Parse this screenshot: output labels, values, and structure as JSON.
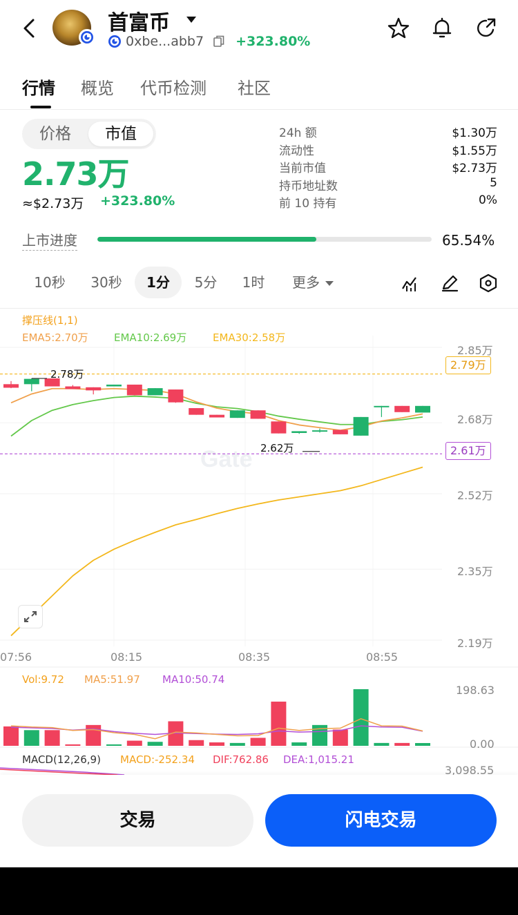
{
  "header": {
    "title": "首富币",
    "address": "0xbe...abb7",
    "change": "+323.80%"
  },
  "tabs": [
    {
      "label": "行情",
      "active": true
    },
    {
      "label": "概览",
      "active": false
    },
    {
      "label": "代币检测",
      "active": false
    },
    {
      "label": "社区",
      "active": false
    }
  ],
  "toggle": {
    "price_label": "价格",
    "mcap_label": "市值",
    "selected": "市值"
  },
  "price": {
    "main": "2.73万",
    "usd": "≈$2.73万",
    "change": "+323.80%"
  },
  "stats": [
    {
      "label": "24h  额",
      "value": "$1.30万"
    },
    {
      "label": "流动性",
      "value": "$1.55万"
    },
    {
      "label": "当前市值",
      "value": "$2.73万"
    },
    {
      "label": "持币地址数",
      "value": "5"
    },
    {
      "label": "前 10 持有",
      "value": "0%"
    }
  ],
  "progress": {
    "label": "上市进度",
    "value_text": "65.54%",
    "fraction": 0.6554
  },
  "intervals": [
    {
      "label": "10秒",
      "selected": false
    },
    {
      "label": "30秒",
      "selected": false
    },
    {
      "label": "1分",
      "selected": true
    },
    {
      "label": "5分",
      "selected": false
    },
    {
      "label": "1时",
      "selected": false
    },
    {
      "label": "更多",
      "selected": false
    }
  ],
  "indicators": {
    "support_label": "撑压线(1,1)",
    "ema5": "EMA5:2.70万",
    "ema10": "EMA10:2.69万",
    "ema30": "EMA30:2.58万"
  },
  "colors": {
    "up": "#20b26c",
    "down": "#f0415c",
    "ema5": "#f0a04b",
    "ema10": "#63c84a",
    "ema30": "#f3b71c",
    "resistance": "#f3b71c",
    "support": "#b24fd6",
    "ma5": "#f0a04b",
    "ma10": "#b24fd6",
    "brand_blue": "#0b5ff9"
  },
  "chart_data": {
    "type": "candlestick",
    "y_unit": "万",
    "y_ticks": [
      "2.85万",
      "2.68万",
      "2.52万",
      "2.35万",
      "2.19万"
    ],
    "x_ticks": [
      "07:56",
      "08:15",
      "08:35",
      "08:55"
    ],
    "resistance_label": "2.79万",
    "support_label": "2.61万",
    "high_marker": "2.78万",
    "low_marker": "2.62万",
    "candles": [
      {
        "open": 2.767,
        "high": 2.774,
        "low": 2.758,
        "close": 2.759
      },
      {
        "open": 2.767,
        "high": 2.78,
        "low": 2.751,
        "close": 2.779
      },
      {
        "open": 2.78,
        "high": 2.78,
        "low": 2.762,
        "close": 2.762
      },
      {
        "open": 2.762,
        "high": 2.765,
        "low": 2.756,
        "close": 2.756
      },
      {
        "open": 2.76,
        "high": 2.76,
        "low": 2.744,
        "close": 2.753
      },
      {
        "open": 2.762,
        "high": 2.766,
        "low": 2.762,
        "close": 2.766
      },
      {
        "open": 2.766,
        "high": 2.766,
        "low": 2.742,
        "close": 2.742
      },
      {
        "open": 2.742,
        "high": 2.758,
        "low": 2.742,
        "close": 2.758
      },
      {
        "open": 2.755,
        "high": 2.755,
        "low": 2.725,
        "close": 2.726
      },
      {
        "open": 2.713,
        "high": 2.713,
        "low": 2.698,
        "close": 2.698
      },
      {
        "open": 2.698,
        "high": 2.698,
        "low": 2.692,
        "close": 2.692
      },
      {
        "open": 2.691,
        "high": 2.708,
        "low": 2.691,
        "close": 2.708
      },
      {
        "open": 2.708,
        "high": 2.708,
        "low": 2.689,
        "close": 2.689
      },
      {
        "open": 2.683,
        "high": 2.683,
        "low": 2.656,
        "close": 2.656
      },
      {
        "open": 2.657,
        "high": 2.661,
        "low": 2.655,
        "close": 2.661
      },
      {
        "open": 2.661,
        "high": 2.667,
        "low": 2.658,
        "close": 2.663
      },
      {
        "open": 2.664,
        "high": 2.664,
        "low": 2.654,
        "close": 2.654
      },
      {
        "open": 2.651,
        "high": 2.693,
        "low": 2.651,
        "close": 2.693
      },
      {
        "open": 2.718,
        "high": 2.718,
        "low": 2.693,
        "close": 2.718
      },
      {
        "open": 2.718,
        "high": 2.718,
        "low": 2.704,
        "close": 2.704
      },
      {
        "open": 2.703,
        "high": 2.718,
        "low": 2.703,
        "close": 2.718
      }
    ],
    "ema5": [
      2.725,
      2.745,
      2.757,
      2.757,
      2.755,
      2.757,
      2.755,
      2.753,
      2.745,
      2.727,
      2.713,
      2.705,
      2.7,
      2.685,
      2.675,
      2.669,
      2.663,
      2.671,
      2.684,
      2.691,
      2.7
    ],
    "ema10": [
      2.65,
      2.685,
      2.708,
      2.721,
      2.73,
      2.737,
      2.74,
      2.738,
      2.735,
      2.724,
      2.716,
      2.712,
      2.705,
      2.695,
      2.688,
      2.682,
      2.676,
      2.676,
      2.683,
      2.687,
      2.693
    ],
    "ema30": [
      2.2,
      2.245,
      2.29,
      2.335,
      2.37,
      2.395,
      2.415,
      2.433,
      2.45,
      2.462,
      2.475,
      2.487,
      2.497,
      2.506,
      2.513,
      2.52,
      2.527,
      2.538,
      2.552,
      2.566,
      2.58
    ],
    "volume": {
      "labels": {
        "vol": "Vol:9.72",
        "ma5": "MA5:51.97",
        "ma10": "MA10:50.74"
      },
      "y_ticks": [
        "198.63",
        "0.00"
      ],
      "max": 198.63,
      "bars": [
        68,
        55,
        55,
        5,
        73,
        5,
        18,
        14,
        86,
        20,
        12,
        10,
        28,
        155,
        12,
        73,
        57,
        198.63,
        10,
        10,
        9.72
      ],
      "ma5": [
        70,
        66,
        64,
        54,
        57,
        46,
        40,
        25,
        48,
        45,
        40,
        35,
        36,
        62,
        54,
        60,
        62,
        95,
        70,
        69,
        52
      ],
      "ma10": [
        65,
        63,
        61,
        55,
        59,
        50,
        44,
        40,
        45,
        43,
        41,
        40,
        42,
        52,
        48,
        50,
        54,
        70,
        66,
        65,
        51
      ]
    },
    "macd": {
      "label": "MACD(12,26,9)",
      "macd": "MACD:-252.34",
      "dif": "DIF:762.86",
      "dea": "DEA:1,015.21",
      "y_tick": "3,098.55"
    }
  },
  "footer": {
    "trade_label": "交易",
    "flash_label": "闪电交易"
  }
}
